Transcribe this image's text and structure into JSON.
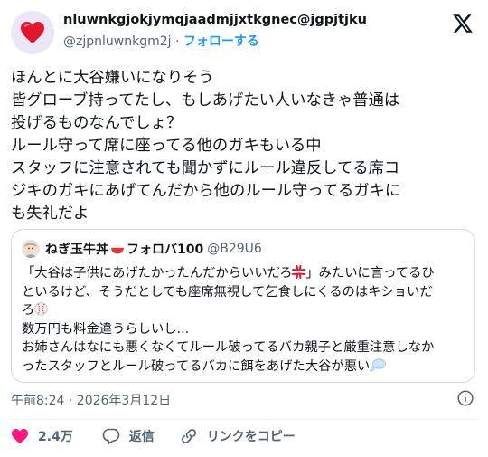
{
  "author": {
    "display_name": "nluwnkgjokjymqjaadmjjxtkgnec@jgpjtjku",
    "handle": "@zjpnluwnkgm2j",
    "separator": "·",
    "follow_label": "フォローする",
    "avatar_icon": "red-heart-icon"
  },
  "tweet": {
    "lines": [
      "ほんとに大谷嫌いになりそう",
      "皆グローブ持ってたし、もしあげたい人いなきゃ普通は",
      "投げるものなんでしょ？",
      "ルール守って席に座ってる他のガキもいる中",
      "スタッフに注意されても聞かずにルール違反してる席コ",
      "ジキのガキにあげてんだから他のルール守ってるガキに",
      "も失礼だよ"
    ]
  },
  "quote": {
    "name": "ねぎ玉牛丼",
    "name_suffix": "フォロバ100",
    "handle": "@B29U6",
    "line1": "「大谷は子供にあげたかったんだからいいだろ",
    "line1_end": "」みたいに言ってるひ",
    "line2": "といるけど、そうだとしても座席無視して乞食しにくるのはキショいだ",
    "line3": "ろ",
    "line4": "数万円も料金違うらしいし...",
    "line5": "お姉さんはなにも悪くなくてルール破ってるバカ親子と厳重注意しなか",
    "line6": "ったスタッフとルール破ってるバカに餌をあげた大谷が悪い"
  },
  "meta": {
    "timestamp": "午前8:24 · 2026年3月12日"
  },
  "actions": {
    "like_count": "2.4万",
    "reply_label": "返信",
    "copy_link_label": "リンクをコピー"
  },
  "colors": {
    "like": "#f91880",
    "link": "#1d9bf0",
    "secondary_text": "#536471"
  }
}
